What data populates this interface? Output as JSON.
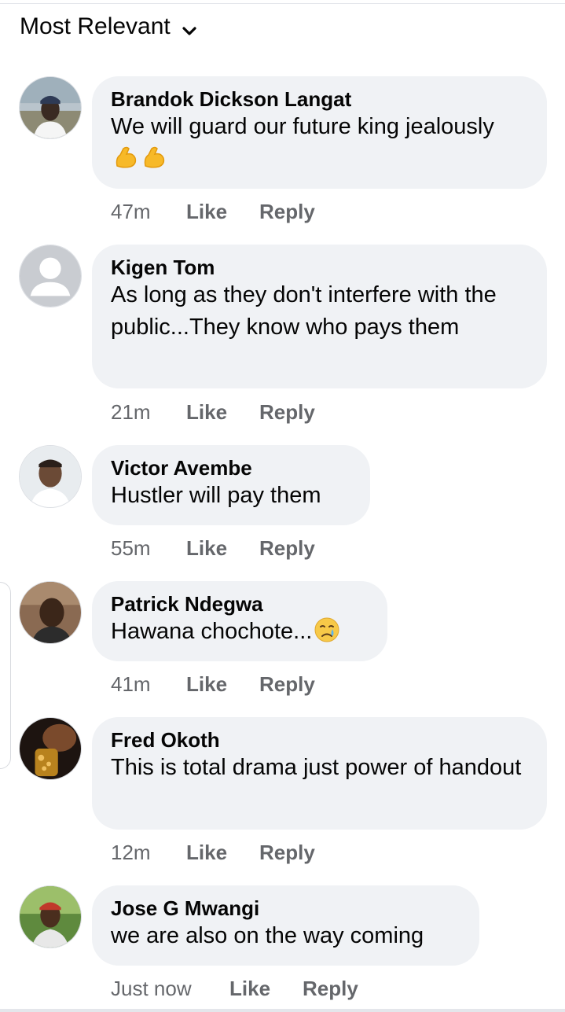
{
  "header": {
    "sort_label": "Most Relevant",
    "sort_icon": "chevron-down-icon"
  },
  "actions": {
    "like_label": "Like",
    "reply_label": "Reply"
  },
  "comments": [
    {
      "author": "Brandok Dickson Langat",
      "text": "We will guard our future king jealously",
      "emoji": [
        "flexed-biceps-icon",
        "flexed-biceps-icon"
      ],
      "time": "47m"
    },
    {
      "author": "Kigen Tom",
      "text": "As long as they don't interfere with the public...They know who pays them",
      "time": "21m"
    },
    {
      "author": "Victor Avembe",
      "text": "Hustler will pay them",
      "time": "55m"
    },
    {
      "author": "Patrick Ndegwa",
      "text": "Hawana chochote...",
      "emoji": [
        "crying-face-icon"
      ],
      "time": "41m"
    },
    {
      "author": "Fred Okoth",
      "text": "This is total drama just power of handout",
      "time": "12m"
    },
    {
      "author": "Jose G Mwangi",
      "text": "we are also on the way coming",
      "time": "Just now"
    }
  ]
}
